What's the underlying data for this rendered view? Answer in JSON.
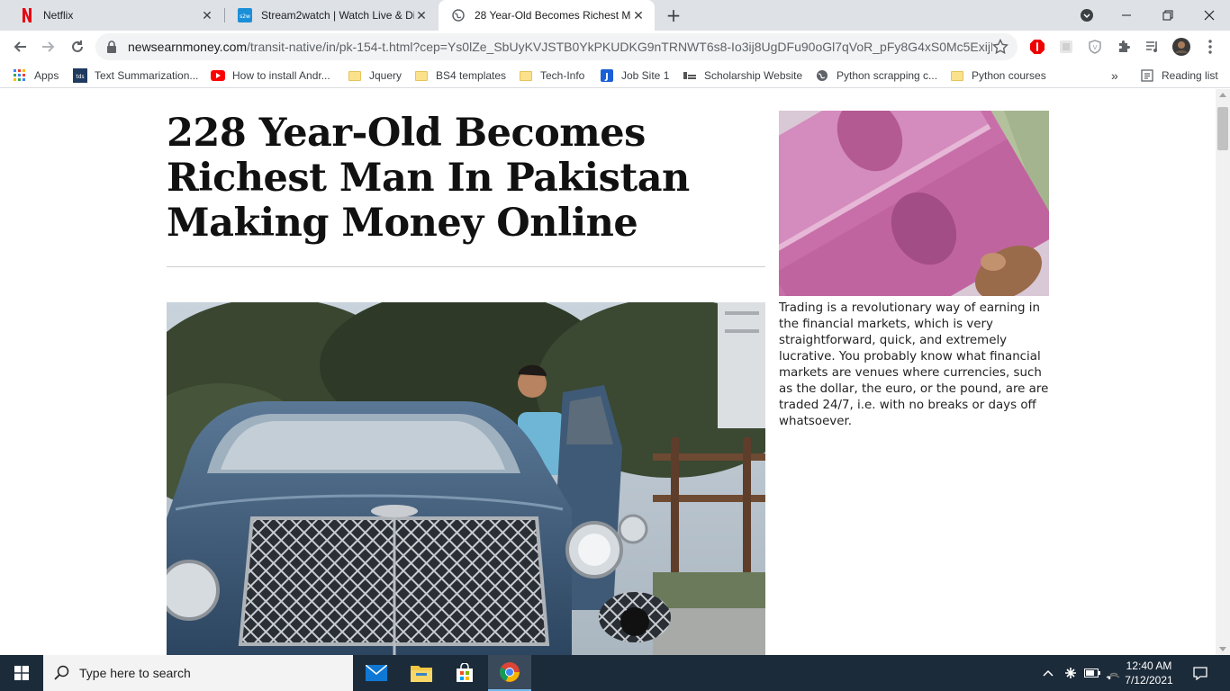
{
  "tabs": [
    {
      "title": "Netflix",
      "favicon": "netflix-icon"
    },
    {
      "title": "Stream2watch | Watch Live & Dir",
      "favicon": "stream2watch-icon"
    },
    {
      "title": "28 Year-Old Becomes Richest Ma",
      "favicon": "globe-icon",
      "active": true
    }
  ],
  "omnibox": {
    "host": "newsearnmoney.com",
    "path": "/transit-native/in/pk-154-t.html?cep=Ys0lZe_SbUyKVJSTB0YkPKUDKG9nTRNWT6s8-Io3ij8UgDFu90oGl7qVoR_pFy8G4xS0Mc5ExijLw..."
  },
  "bookmarks": [
    {
      "label": "Apps",
      "icon": "apps-grid-icon"
    },
    {
      "label": "Text Summarization...",
      "icon": "tds-icon"
    },
    {
      "label": "How to install Andr...",
      "icon": "youtube-icon"
    },
    {
      "label": "Jquery",
      "icon": "folder-icon"
    },
    {
      "label": "BS4 templates",
      "icon": "folder-icon"
    },
    {
      "label": "Tech-Info",
      "icon": "folder-icon"
    },
    {
      "label": "Job Site 1",
      "icon": "j-icon"
    },
    {
      "label": "Scholarship Website",
      "icon": "site-icon"
    },
    {
      "label": "Python scrapping c...",
      "icon": "globe-icon"
    },
    {
      "label": "Python courses",
      "icon": "folder-icon"
    }
  ],
  "reading_list": "Reading list",
  "more_bookmarks": "»",
  "article": {
    "headline_lines": [
      "228 Year-Old Becomes",
      "Richest Man In Pakistan",
      "Making Money Online"
    ],
    "sidebar_text": "Trading is a revolutionary way of earning in the financial markets, which is very straightforward, quick, and extremely lucrative. You probably know what financial markets are venues where currencies, such as the dollar, the euro, or the pound, are are traded 24/7, i.e. with no breaks or days off whatsoever."
  },
  "taskbar": {
    "search_placeholder": "Type here to search",
    "time": "12:40 AM",
    "date": "7/12/2021"
  },
  "colors": {
    "tabstrip": "#dee1e6",
    "taskbar": "#1c2b3a",
    "headline": "#111111",
    "netflix_red": "#e50914"
  }
}
